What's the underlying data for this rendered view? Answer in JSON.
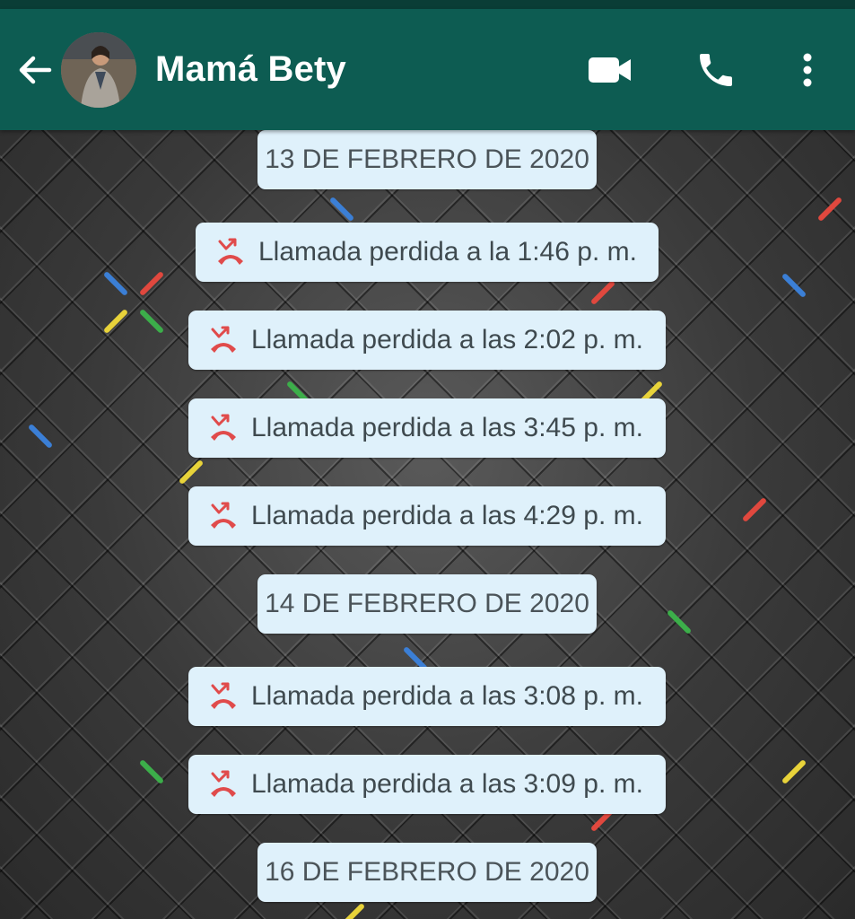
{
  "header": {
    "contact_name": "Mamá Bety",
    "icons": [
      "back-arrow-icon",
      "video-call-icon",
      "voice-call-icon",
      "more-options-icon"
    ]
  },
  "colors": {
    "header": "#0d5c52",
    "bubble": "#dff1fb",
    "missed_call": "#e04b4b"
  },
  "messages": [
    {
      "type": "date",
      "text": "13 DE FEBRERO DE 2020"
    },
    {
      "type": "missed_call",
      "text": "Llamada perdida a la 1:46 p. m."
    },
    {
      "type": "missed_call",
      "text": "Llamada perdida a las 2:02 p. m."
    },
    {
      "type": "missed_call",
      "text": "Llamada perdida a las 3:45 p. m."
    },
    {
      "type": "missed_call",
      "text": "Llamada perdida a las 4:29 p. m."
    },
    {
      "type": "date",
      "text": "14 DE FEBRERO DE 2020"
    },
    {
      "type": "missed_call",
      "text": "Llamada perdida a las 3:08 p. m."
    },
    {
      "type": "missed_call",
      "text": "Llamada perdida a las 3:09 p. m."
    },
    {
      "type": "date",
      "text": "16 DE FEBRERO DE 2020"
    }
  ]
}
